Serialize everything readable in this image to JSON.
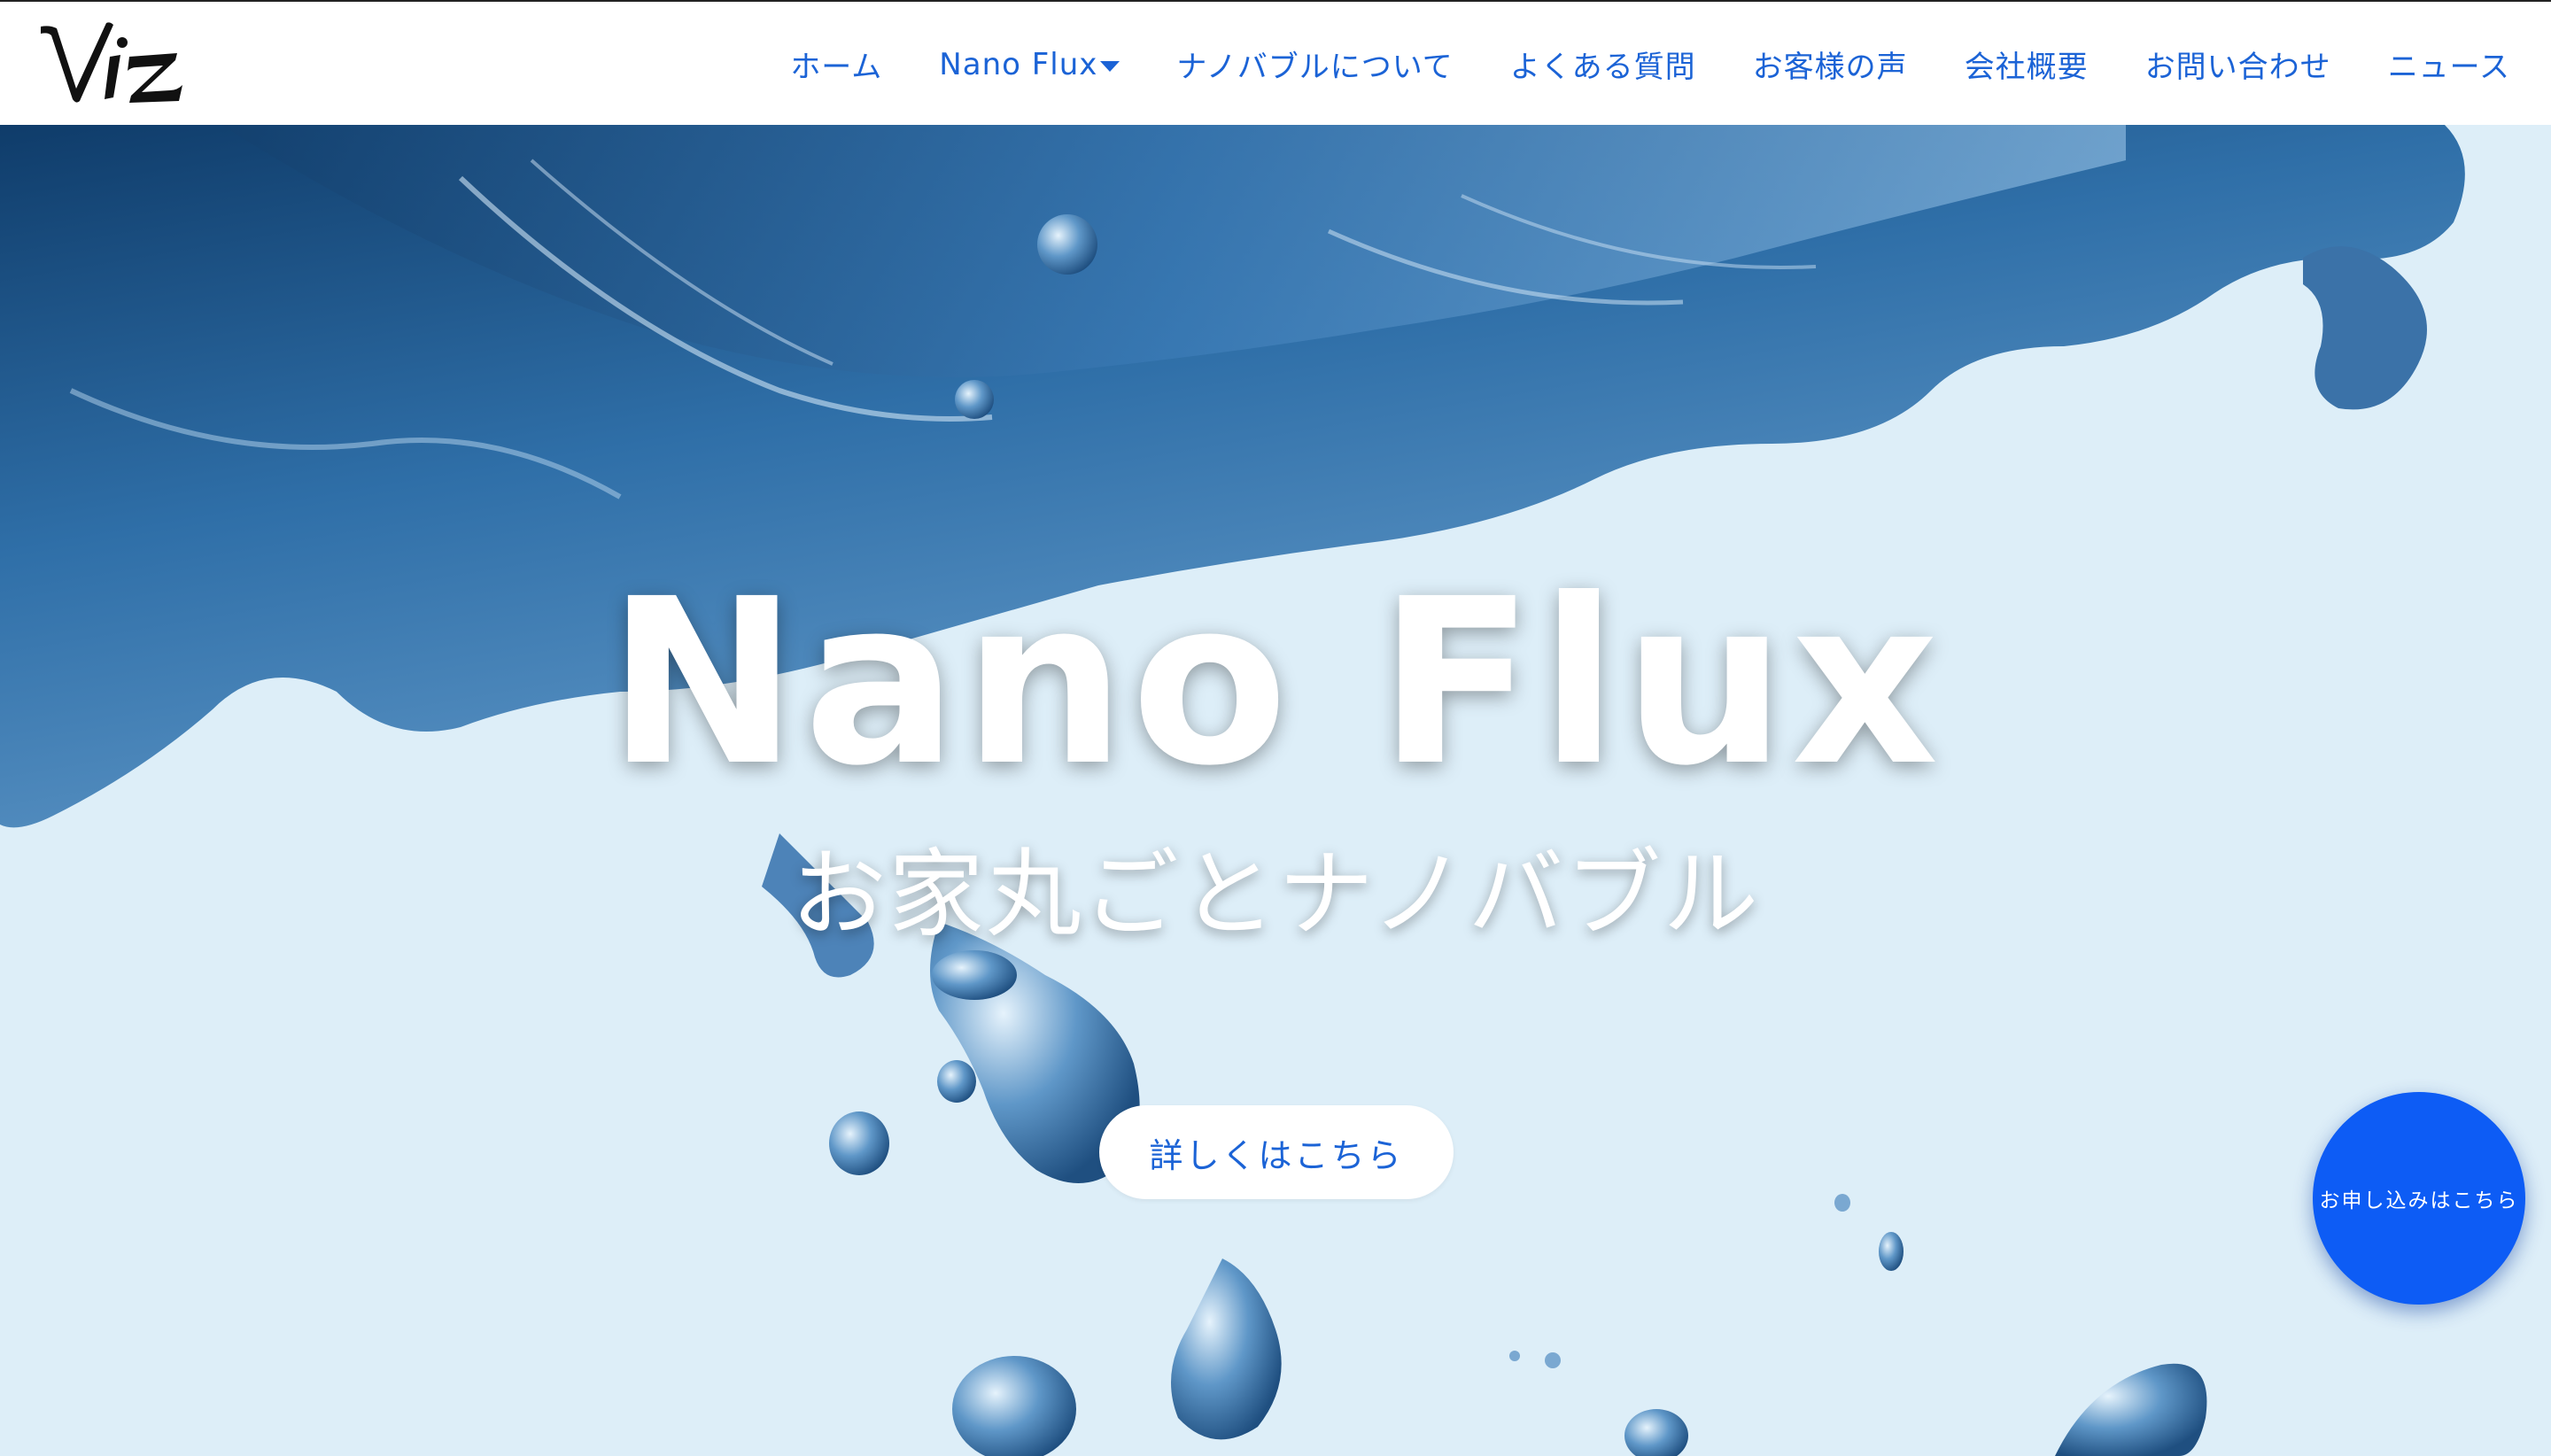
{
  "header": {
    "logo_text": "Viz",
    "nav": [
      {
        "label": "ホーム"
      },
      {
        "label": "Nano Flux",
        "has_dropdown": true
      },
      {
        "label": "ナノバブルについて"
      },
      {
        "label": "よくある質問"
      },
      {
        "label": "お客様の声"
      },
      {
        "label": "会社概要"
      },
      {
        "label": "お問い合わせ"
      },
      {
        "label": "ニュース"
      }
    ]
  },
  "hero": {
    "title": "Nano Flux",
    "subtitle": "お家丸ごとナノバブル",
    "cta_label": "詳しくはこちら"
  },
  "floating_button": {
    "label": "お申し込みはこちら"
  },
  "colors": {
    "accent": "#1b63d6",
    "apply_button": "#0d5cf5",
    "hero_background": "#ddeef8",
    "water_dark": "#1e4f80"
  },
  "icons": {
    "dropdown": "caret-down-icon"
  }
}
